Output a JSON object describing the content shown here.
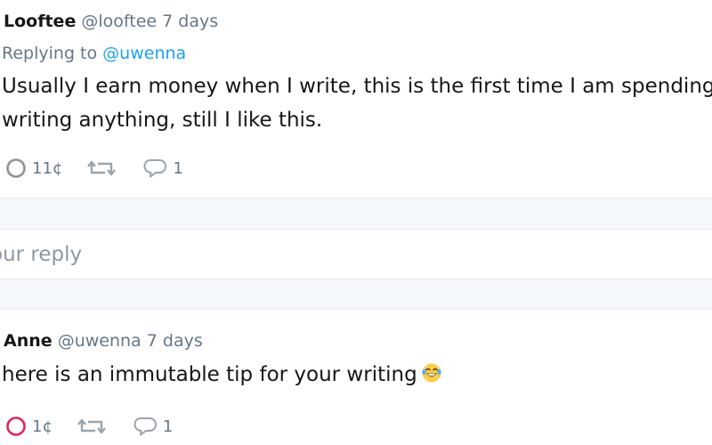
{
  "colors": {
    "link": "#1da1f2",
    "muted": "#657786",
    "tip_active": "#e0245e",
    "band": "#f5f8fa"
  },
  "tweets": [
    {
      "display_name": "Looftee",
      "handle": "@looftee",
      "time": "7 days",
      "replying_prefix": "Replying to",
      "replying_to": "@uwenna",
      "text_line1": "Usually I earn money when I write, this is the first time I am spending fo",
      "text_line2": "writing anything, still I like this.",
      "tip_amount": "11¢",
      "reply_count": "1",
      "icons": [
        "tip-circle-icon",
        "retweet-icon",
        "reply-bubble-icon"
      ]
    },
    {
      "display_name": "Anne",
      "handle": "@uwenna",
      "time": "7 days",
      "text": "here is an immutable tip for your writing",
      "emoji": "laughing-tears-emoji",
      "tip_amount": "1¢",
      "reply_count": "1",
      "icons": [
        "tip-circle-icon",
        "retweet-icon",
        "reply-bubble-icon"
      ]
    }
  ],
  "reply": {
    "placeholder": "Your reply"
  }
}
